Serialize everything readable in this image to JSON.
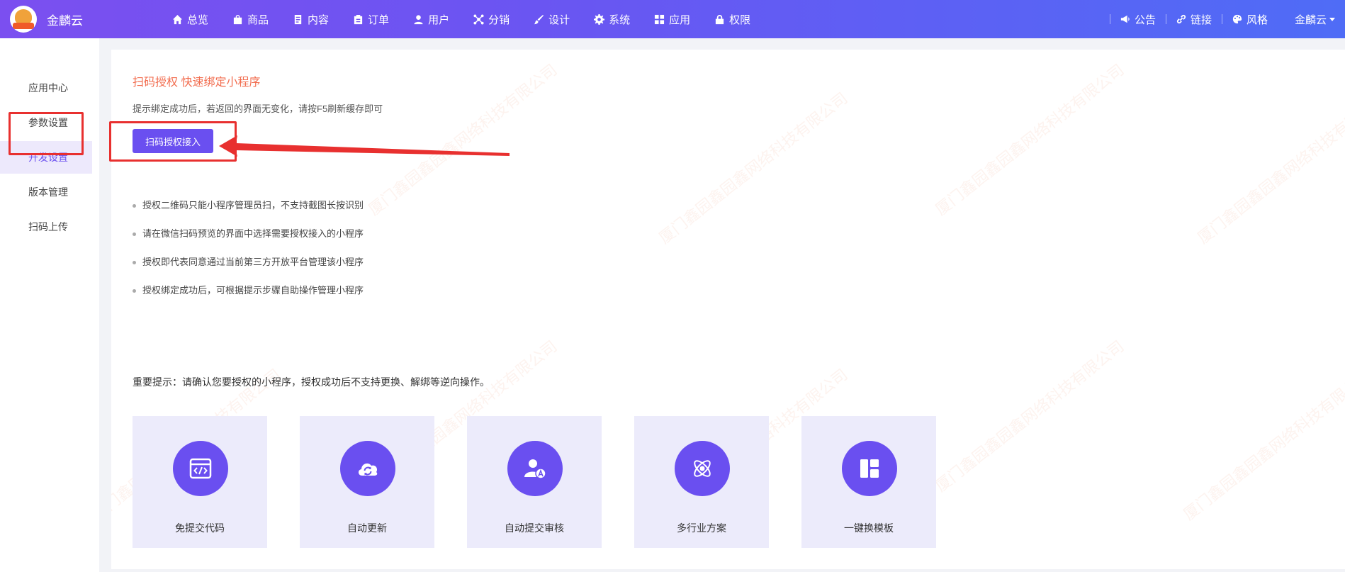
{
  "header": {
    "brand": "金麟云",
    "nav": [
      {
        "label": "总览",
        "icon": "home-icon"
      },
      {
        "label": "商品",
        "icon": "bag-icon"
      },
      {
        "label": "内容",
        "icon": "document-icon"
      },
      {
        "label": "订单",
        "icon": "clipboard-icon"
      },
      {
        "label": "用户",
        "icon": "user-icon"
      },
      {
        "label": "分销",
        "icon": "share-icon"
      },
      {
        "label": "设计",
        "icon": "brush-icon"
      },
      {
        "label": "系统",
        "icon": "gear-icon"
      },
      {
        "label": "应用",
        "icon": "grid-icon"
      },
      {
        "label": "权限",
        "icon": "lock-icon"
      }
    ],
    "right": [
      {
        "label": "公告",
        "icon": "megaphone-icon"
      },
      {
        "label": "链接",
        "icon": "link-icon"
      },
      {
        "label": "风格",
        "icon": "palette-icon"
      }
    ],
    "user": "金麟云"
  },
  "sidebar": {
    "items": [
      "应用中心",
      "参数设置",
      "开发设置",
      "版本管理",
      "扫码上传"
    ],
    "active_index": 2
  },
  "main": {
    "title": "扫码授权 快速绑定小程序",
    "hint": "提示绑定成功后，若返回的界面无变化，请按F5刷新缓存即可",
    "button_label": "扫码授权接入",
    "tips": [
      "授权二维码只能小程序管理员扫，不支持截图长按识别",
      "请在微信扫码预览的界面中选择需要授权接入的小程序",
      "授权即代表同意通过当前第三方开放平台管理该小程序",
      "授权绑定成功后，可根据提示步骤自助操作管理小程序"
    ],
    "important": "重要提示：请确认您要授权的小程序，授权成功后不支持更换、解绑等逆向操作。",
    "features": [
      {
        "label": "免提交代码",
        "icon": "code-window-icon"
      },
      {
        "label": "自动更新",
        "icon": "cloud-refresh-icon"
      },
      {
        "label": "自动提交审核",
        "icon": "user-review-icon"
      },
      {
        "label": "多行业方案",
        "icon": "atom-icon"
      },
      {
        "label": "一键换模板",
        "icon": "template-layout-icon"
      }
    ],
    "watermark": "厦门鑫园鑫园鑫网络科技有限公司"
  },
  "colors": {
    "primary": "#6a4ff0",
    "header_gradient_start": "#7b4ff0",
    "header_gradient_end": "#4f6cf6",
    "title_orange": "#f26d4f",
    "annotation_red": "#e8302f",
    "feature_bg": "#ecebfb"
  }
}
